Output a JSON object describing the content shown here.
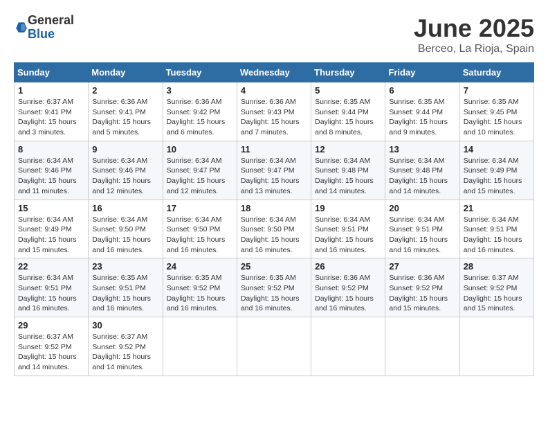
{
  "header": {
    "logo_general": "General",
    "logo_blue": "Blue",
    "month_title": "June 2025",
    "location": "Berceo, La Rioja, Spain"
  },
  "calendar": {
    "days_of_week": [
      "Sunday",
      "Monday",
      "Tuesday",
      "Wednesday",
      "Thursday",
      "Friday",
      "Saturday"
    ],
    "weeks": [
      [
        null,
        {
          "day": "2",
          "sunrise": "Sunrise: 6:36 AM",
          "sunset": "Sunset: 9:41 PM",
          "daylight": "Daylight: 15 hours and 5 minutes."
        },
        {
          "day": "3",
          "sunrise": "Sunrise: 6:36 AM",
          "sunset": "Sunset: 9:42 PM",
          "daylight": "Daylight: 15 hours and 6 minutes."
        },
        {
          "day": "4",
          "sunrise": "Sunrise: 6:36 AM",
          "sunset": "Sunset: 9:43 PM",
          "daylight": "Daylight: 15 hours and 7 minutes."
        },
        {
          "day": "5",
          "sunrise": "Sunrise: 6:35 AM",
          "sunset": "Sunset: 9:44 PM",
          "daylight": "Daylight: 15 hours and 8 minutes."
        },
        {
          "day": "6",
          "sunrise": "Sunrise: 6:35 AM",
          "sunset": "Sunset: 9:44 PM",
          "daylight": "Daylight: 15 hours and 9 minutes."
        },
        {
          "day": "7",
          "sunrise": "Sunrise: 6:35 AM",
          "sunset": "Sunset: 9:45 PM",
          "daylight": "Daylight: 15 hours and 10 minutes."
        }
      ],
      [
        {
          "day": "8",
          "sunrise": "Sunrise: 6:34 AM",
          "sunset": "Sunset: 9:46 PM",
          "daylight": "Daylight: 15 hours and 11 minutes."
        },
        {
          "day": "9",
          "sunrise": "Sunrise: 6:34 AM",
          "sunset": "Sunset: 9:46 PM",
          "daylight": "Daylight: 15 hours and 12 minutes."
        },
        {
          "day": "10",
          "sunrise": "Sunrise: 6:34 AM",
          "sunset": "Sunset: 9:47 PM",
          "daylight": "Daylight: 15 hours and 12 minutes."
        },
        {
          "day": "11",
          "sunrise": "Sunrise: 6:34 AM",
          "sunset": "Sunset: 9:47 PM",
          "daylight": "Daylight: 15 hours and 13 minutes."
        },
        {
          "day": "12",
          "sunrise": "Sunrise: 6:34 AM",
          "sunset": "Sunset: 9:48 PM",
          "daylight": "Daylight: 15 hours and 14 minutes."
        },
        {
          "day": "13",
          "sunrise": "Sunrise: 6:34 AM",
          "sunset": "Sunset: 9:48 PM",
          "daylight": "Daylight: 15 hours and 14 minutes."
        },
        {
          "day": "14",
          "sunrise": "Sunrise: 6:34 AM",
          "sunset": "Sunset: 9:49 PM",
          "daylight": "Daylight: 15 hours and 15 minutes."
        }
      ],
      [
        {
          "day": "15",
          "sunrise": "Sunrise: 6:34 AM",
          "sunset": "Sunset: 9:49 PM",
          "daylight": "Daylight: 15 hours and 15 minutes."
        },
        {
          "day": "16",
          "sunrise": "Sunrise: 6:34 AM",
          "sunset": "Sunset: 9:50 PM",
          "daylight": "Daylight: 15 hours and 16 minutes."
        },
        {
          "day": "17",
          "sunrise": "Sunrise: 6:34 AM",
          "sunset": "Sunset: 9:50 PM",
          "daylight": "Daylight: 15 hours and 16 minutes."
        },
        {
          "day": "18",
          "sunrise": "Sunrise: 6:34 AM",
          "sunset": "Sunset: 9:50 PM",
          "daylight": "Daylight: 15 hours and 16 minutes."
        },
        {
          "day": "19",
          "sunrise": "Sunrise: 6:34 AM",
          "sunset": "Sunset: 9:51 PM",
          "daylight": "Daylight: 15 hours and 16 minutes."
        },
        {
          "day": "20",
          "sunrise": "Sunrise: 6:34 AM",
          "sunset": "Sunset: 9:51 PM",
          "daylight": "Daylight: 15 hours and 16 minutes."
        },
        {
          "day": "21",
          "sunrise": "Sunrise: 6:34 AM",
          "sunset": "Sunset: 9:51 PM",
          "daylight": "Daylight: 15 hours and 16 minutes."
        }
      ],
      [
        {
          "day": "22",
          "sunrise": "Sunrise: 6:34 AM",
          "sunset": "Sunset: 9:51 PM",
          "daylight": "Daylight: 15 hours and 16 minutes."
        },
        {
          "day": "23",
          "sunrise": "Sunrise: 6:35 AM",
          "sunset": "Sunset: 9:51 PM",
          "daylight": "Daylight: 15 hours and 16 minutes."
        },
        {
          "day": "24",
          "sunrise": "Sunrise: 6:35 AM",
          "sunset": "Sunset: 9:52 PM",
          "daylight": "Daylight: 15 hours and 16 minutes."
        },
        {
          "day": "25",
          "sunrise": "Sunrise: 6:35 AM",
          "sunset": "Sunset: 9:52 PM",
          "daylight": "Daylight: 15 hours and 16 minutes."
        },
        {
          "day": "26",
          "sunrise": "Sunrise: 6:36 AM",
          "sunset": "Sunset: 9:52 PM",
          "daylight": "Daylight: 15 hours and 16 minutes."
        },
        {
          "day": "27",
          "sunrise": "Sunrise: 6:36 AM",
          "sunset": "Sunset: 9:52 PM",
          "daylight": "Daylight: 15 hours and 15 minutes."
        },
        {
          "day": "28",
          "sunrise": "Sunrise: 6:37 AM",
          "sunset": "Sunset: 9:52 PM",
          "daylight": "Daylight: 15 hours and 15 minutes."
        }
      ],
      [
        {
          "day": "29",
          "sunrise": "Sunrise: 6:37 AM",
          "sunset": "Sunset: 9:52 PM",
          "daylight": "Daylight: 15 hours and 14 minutes."
        },
        {
          "day": "30",
          "sunrise": "Sunrise: 6:37 AM",
          "sunset": "Sunset: 9:52 PM",
          "daylight": "Daylight: 15 hours and 14 minutes."
        },
        null,
        null,
        null,
        null,
        null
      ]
    ],
    "week1_sunday": {
      "day": "1",
      "sunrise": "Sunrise: 6:37 AM",
      "sunset": "Sunset: 9:41 PM",
      "daylight": "Daylight: 15 hours and 3 minutes."
    }
  }
}
